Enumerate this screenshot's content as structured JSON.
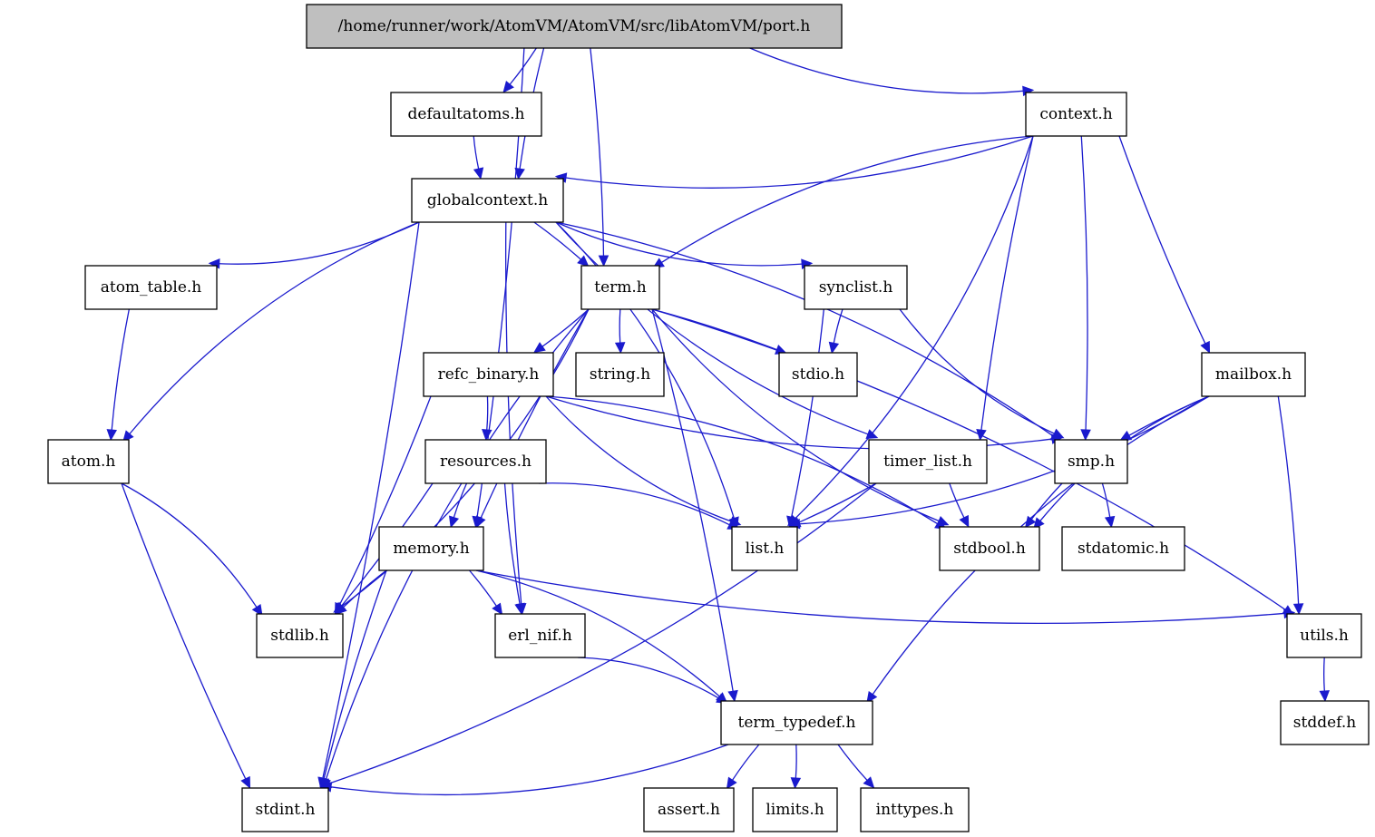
{
  "title": "/home/runner/work/AtomVM/AtomVM/src/libAtomVM/port.h",
  "colors": {
    "edge": "#1a1acd",
    "root_fill": "#bfbfbf",
    "node_fill": "#ffffff",
    "node_stroke": "#000000"
  },
  "nodes": [
    {
      "id": "port",
      "label": "/home/runner/work/AtomVM/AtomVM/src/libAtomVM/port.h",
      "root": true
    },
    {
      "id": "defaultatoms",
      "label": "defaultatoms.h"
    },
    {
      "id": "context",
      "label": "context.h"
    },
    {
      "id": "globalcontext",
      "label": "globalcontext.h"
    },
    {
      "id": "atom_table",
      "label": "atom_table.h"
    },
    {
      "id": "term",
      "label": "term.h"
    },
    {
      "id": "synclist",
      "label": "synclist.h"
    },
    {
      "id": "refc_binary",
      "label": "refc_binary.h"
    },
    {
      "id": "string",
      "label": "string.h"
    },
    {
      "id": "stdio",
      "label": "stdio.h"
    },
    {
      "id": "mailbox",
      "label": "mailbox.h"
    },
    {
      "id": "atom",
      "label": "atom.h"
    },
    {
      "id": "resources",
      "label": "resources.h"
    },
    {
      "id": "timer_list",
      "label": "timer_list.h"
    },
    {
      "id": "smp",
      "label": "smp.h"
    },
    {
      "id": "memory",
      "label": "memory.h"
    },
    {
      "id": "list",
      "label": "list.h"
    },
    {
      "id": "stdbool",
      "label": "stdbool.h"
    },
    {
      "id": "stdatomic",
      "label": "stdatomic.h"
    },
    {
      "id": "stdlib",
      "label": "stdlib.h"
    },
    {
      "id": "erl_nif",
      "label": "erl_nif.h"
    },
    {
      "id": "utils",
      "label": "utils.h"
    },
    {
      "id": "term_typedef",
      "label": "term_typedef.h"
    },
    {
      "id": "stddef",
      "label": "stddef.h"
    },
    {
      "id": "stdint",
      "label": "stdint.h"
    },
    {
      "id": "assert",
      "label": "assert.h"
    },
    {
      "id": "limits",
      "label": "limits.h"
    },
    {
      "id": "inttypes",
      "label": "inttypes.h"
    }
  ],
  "edges": [
    [
      "port",
      "defaultatoms"
    ],
    [
      "port",
      "globalcontext"
    ],
    [
      "port",
      "term"
    ],
    [
      "port",
      "context"
    ],
    [
      "port",
      "memory"
    ],
    [
      "defaultatoms",
      "globalcontext"
    ],
    [
      "context",
      "globalcontext"
    ],
    [
      "context",
      "term"
    ],
    [
      "context",
      "list"
    ],
    [
      "context",
      "timer_list"
    ],
    [
      "context",
      "smp"
    ],
    [
      "context",
      "mailbox"
    ],
    [
      "globalcontext",
      "atom_table"
    ],
    [
      "globalcontext",
      "atom"
    ],
    [
      "globalcontext",
      "term"
    ],
    [
      "globalcontext",
      "synclist"
    ],
    [
      "globalcontext",
      "stdint"
    ],
    [
      "globalcontext",
      "erl_nif"
    ],
    [
      "globalcontext",
      "list"
    ],
    [
      "globalcontext",
      "timer_list"
    ],
    [
      "globalcontext",
      "smp"
    ],
    [
      "atom_table",
      "atom"
    ],
    [
      "term",
      "refc_binary"
    ],
    [
      "term",
      "string"
    ],
    [
      "term",
      "stdio"
    ],
    [
      "term",
      "memory"
    ],
    [
      "term",
      "stdlib"
    ],
    [
      "term",
      "stdint"
    ],
    [
      "term",
      "term_typedef"
    ],
    [
      "term",
      "stdbool"
    ],
    [
      "term",
      "utils"
    ],
    [
      "synclist",
      "stdio"
    ],
    [
      "synclist",
      "list"
    ],
    [
      "synclist",
      "smp"
    ],
    [
      "refc_binary",
      "resources"
    ],
    [
      "refc_binary",
      "list"
    ],
    [
      "refc_binary",
      "stdbool"
    ],
    [
      "refc_binary",
      "smp"
    ],
    [
      "refc_binary",
      "stdlib"
    ],
    [
      "resources",
      "memory"
    ],
    [
      "resources",
      "list"
    ],
    [
      "resources",
      "erl_nif"
    ],
    [
      "resources",
      "stdlib"
    ],
    [
      "mailbox",
      "smp"
    ],
    [
      "mailbox",
      "list"
    ],
    [
      "mailbox",
      "stdbool"
    ],
    [
      "mailbox",
      "utils"
    ],
    [
      "mailbox",
      "term_typedef"
    ],
    [
      "atom",
      "stdlib"
    ],
    [
      "atom",
      "stdint"
    ],
    [
      "timer_list",
      "list"
    ],
    [
      "timer_list",
      "stdbool"
    ],
    [
      "timer_list",
      "stdint"
    ],
    [
      "smp",
      "stdbool"
    ],
    [
      "smp",
      "stdatomic"
    ],
    [
      "memory",
      "stdlib"
    ],
    [
      "memory",
      "erl_nif"
    ],
    [
      "memory",
      "stdint"
    ],
    [
      "memory",
      "term_typedef"
    ],
    [
      "memory",
      "utils"
    ],
    [
      "erl_nif",
      "term_typedef"
    ],
    [
      "utils",
      "stddef"
    ],
    [
      "term_typedef",
      "stdint"
    ],
    [
      "term_typedef",
      "assert"
    ],
    [
      "term_typedef",
      "limits"
    ],
    [
      "term_typedef",
      "inttypes"
    ]
  ]
}
